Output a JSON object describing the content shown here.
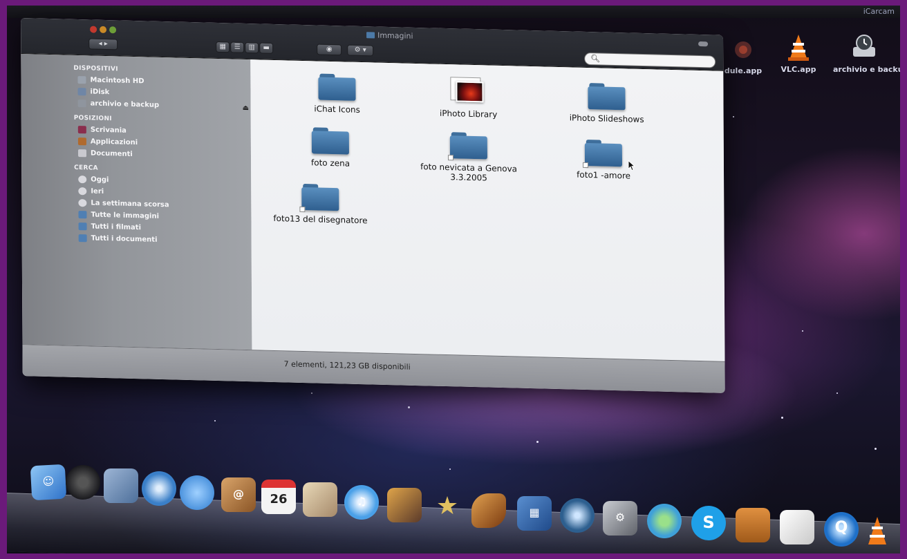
{
  "menubar": {
    "right_text": "iCarcam"
  },
  "window": {
    "title": "Immagini",
    "search": {
      "value": "",
      "placeholder": ""
    },
    "sidebar": {
      "sections": [
        {
          "title": "DISPOSITIVI",
          "items": [
            {
              "label": "Macintosh HD",
              "icon": "hard-drive-icon",
              "color": "#9aa2ad"
            },
            {
              "label": "iDisk",
              "icon": "idisk-icon",
              "color": "#6f86a6"
            },
            {
              "label": "archivio e backup",
              "icon": "external-drive-icon",
              "color": "#8f959e",
              "eject": true
            }
          ]
        },
        {
          "title": "POSIZIONI",
          "items": [
            {
              "label": "Scrivania",
              "icon": "desktop-icon",
              "color": "#8a2e4d"
            },
            {
              "label": "Applicazioni",
              "icon": "applications-icon",
              "color": "#b06a2e"
            },
            {
              "label": "Documenti",
              "icon": "documents-icon",
              "color": "#c9c9cf"
            }
          ]
        },
        {
          "title": "CERCA",
          "items": [
            {
              "label": "Oggi",
              "icon": "clock-icon",
              "color": "#d9d9de"
            },
            {
              "label": "Ieri",
              "icon": "clock-icon",
              "color": "#d9d9de"
            },
            {
              "label": "La settimana scorsa",
              "icon": "clock-icon",
              "color": "#d9d9de"
            },
            {
              "label": "Tutte le immagini",
              "icon": "smart-folder-icon",
              "color": "#4f7fb3"
            },
            {
              "label": "Tutti i filmati",
              "icon": "smart-folder-icon",
              "color": "#4f7fb3"
            },
            {
              "label": "Tutti i documenti",
              "icon": "smart-folder-icon",
              "color": "#4f7fb3"
            }
          ]
        }
      ]
    },
    "items": [
      {
        "name": "iChat Icons",
        "icon": "folder-icon"
      },
      {
        "name": "iPhoto Library",
        "icon": "iphoto-library-icon"
      },
      {
        "name": "iPhoto Slideshows",
        "icon": "folder-icon"
      },
      {
        "name": "foto zena",
        "icon": "folder-icon"
      },
      {
        "name": "foto nevicata a Genova 3.3.2005",
        "icon": "folder-icon"
      },
      {
        "name": "foto1 -amore",
        "icon": "folder-icon"
      },
      {
        "name": "foto13 del disegnatore",
        "icon": "folder-icon"
      }
    ],
    "status": "7 elementi, 121,23 GB disponibili"
  },
  "desktop_icons": [
    {
      "label": "dule.app",
      "icon": "app-icon"
    },
    {
      "label": "VLC.app",
      "icon": "vlc-icon"
    },
    {
      "label": "archivio e backup",
      "icon": "time-machine-drive-icon"
    }
  ],
  "dock": {
    "calendar_date": "26",
    "apps": [
      {
        "name": "finder",
        "color": "#4a8fd8"
      },
      {
        "name": "dashboard",
        "color": "#2a2a2e"
      },
      {
        "name": "mail",
        "color": "#6e8fb8"
      },
      {
        "name": "safari",
        "color": "#3a7fc8"
      },
      {
        "name": "ichat",
        "color": "#3b8fe0"
      },
      {
        "name": "address-book",
        "color": "#a86a3a"
      },
      {
        "name": "ical",
        "color": "#f2f2f2"
      },
      {
        "name": "preview",
        "color": "#c9a67a"
      },
      {
        "name": "itunes",
        "color": "#4aa0e8"
      },
      {
        "name": "iphoto",
        "color": "#5b7fa8"
      },
      {
        "name": "imovie",
        "color": "#c8a24a"
      },
      {
        "name": "garageband",
        "color": "#b0702a"
      },
      {
        "name": "spaces",
        "color": "#3a6fb0"
      },
      {
        "name": "time-machine",
        "color": "#2d5f8f"
      },
      {
        "name": "system-preferences",
        "color": "#8a8c92"
      },
      {
        "name": "messenger",
        "color": "#3fa0d8"
      },
      {
        "name": "skype",
        "color": "#1fa0e8"
      },
      {
        "name": "keynote",
        "color": "#c07a2a"
      },
      {
        "name": "textedit",
        "color": "#e8e8e8"
      },
      {
        "name": "quicktime",
        "color": "#1f70c8"
      },
      {
        "name": "vlc",
        "color": "#e8701a"
      }
    ]
  }
}
